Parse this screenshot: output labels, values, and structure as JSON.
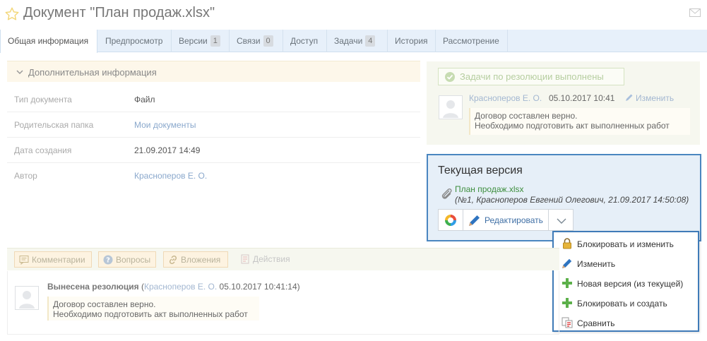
{
  "header": {
    "title": "Документ \"План продаж.xlsx\""
  },
  "tabs": [
    {
      "label": "Общая информация",
      "badge": null,
      "active": true
    },
    {
      "label": "Предпросмотр",
      "badge": null
    },
    {
      "label": "Версии",
      "badge": "1"
    },
    {
      "label": "Связи",
      "badge": "0"
    },
    {
      "label": "Доступ",
      "badge": null
    },
    {
      "label": "Задачи",
      "badge": "4"
    },
    {
      "label": "История",
      "badge": null
    },
    {
      "label": "Рассмотрение",
      "badge": null
    }
  ],
  "additional_info": {
    "title": "Дополнительная информация",
    "rows": [
      {
        "key": "Тип документа",
        "value": "Файл"
      },
      {
        "key": "Родительская папка",
        "value": "Мои документы"
      },
      {
        "key": "Дата создания",
        "value": "21.09.2017 14:49"
      },
      {
        "key": "Автор",
        "value": "Красноперов Е. О."
      }
    ]
  },
  "resolution": {
    "status": "Задачи по резолюции выполнены",
    "author": "Красноперов Е. О.",
    "date": "05.10.2017 10:41",
    "edit_label": "Изменить",
    "note_line1": "Договор составлен верно.",
    "note_line2": "Необходимо подготовить акт выполненных работ"
  },
  "current_version": {
    "title": "Текущая версия",
    "file_name": "План продаж.xlsx",
    "meta": "(№1, Красноперов Евгений Олегович, 21.09.2017 14:50:08)",
    "edit_button": "Редактировать"
  },
  "dropdown": {
    "items": [
      {
        "label": "Блокировать и изменить",
        "icon": "lock-icon"
      },
      {
        "label": "Изменить",
        "icon": "pencil-icon"
      },
      {
        "label": "Новая версия (из текущей)",
        "icon": "plus-icon"
      },
      {
        "label": "Блокировать и создать",
        "icon": "plus-icon"
      },
      {
        "label": "Сравнить",
        "icon": "compare-icon"
      }
    ]
  },
  "bottom_toolbar": {
    "comments": "Комментарии",
    "questions": "Вопросы",
    "attachments": "Вложения",
    "actions": "Действия"
  },
  "comment": {
    "title": "Вынесена резолюция",
    "author": "Красноперов Е. О.",
    "date": "05.10.2017 10:41:14",
    "line1": "Договор составлен верно.",
    "line2": "Необходимо подготовить акт выполненных работ"
  },
  "colors": {
    "tab_bar": "#e7f0fa",
    "accent_border": "#4a86c0",
    "current_version_bg": "#e6eff8",
    "file_link": "#3e8e3e",
    "link": "#a3b7d1"
  }
}
